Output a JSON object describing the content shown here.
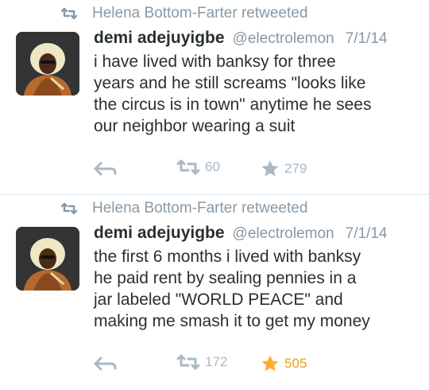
{
  "colors": {
    "muted": "#8899a6",
    "action": "#aab8c2",
    "favorite_active": "#ffac33",
    "text": "#292f33"
  },
  "tweets": [
    {
      "retweeted_by": "Helena Bottom-Farter retweeted",
      "author_name": "demi adejuyigbe",
      "author_handle": "@electrolemon",
      "date": "7/1/14",
      "text": "i have lived with banksy for three\nyears and he still screams \"looks like\nthe circus is in town\" anytime he sees\nour neighbor wearing a suit",
      "retweet_count": "60",
      "favorite_count": "279",
      "favorited": false
    },
    {
      "retweeted_by": "Helena Bottom-Farter retweeted",
      "author_name": "demi adejuyigbe",
      "author_handle": "@electrolemon",
      "date": "7/1/14",
      "text": "the first 6 months i lived with banksy\nhe paid rent by sealing pennies in a\njar labeled \"WORLD PEACE\" and\nmaking me smash it to get my money",
      "retweet_count": "172",
      "favorite_count": "505",
      "favorited": true
    }
  ],
  "icons": {
    "retweet": "retweet-icon",
    "reply": "reply-icon",
    "favorite": "star-icon",
    "avatar": "avatar-image"
  }
}
